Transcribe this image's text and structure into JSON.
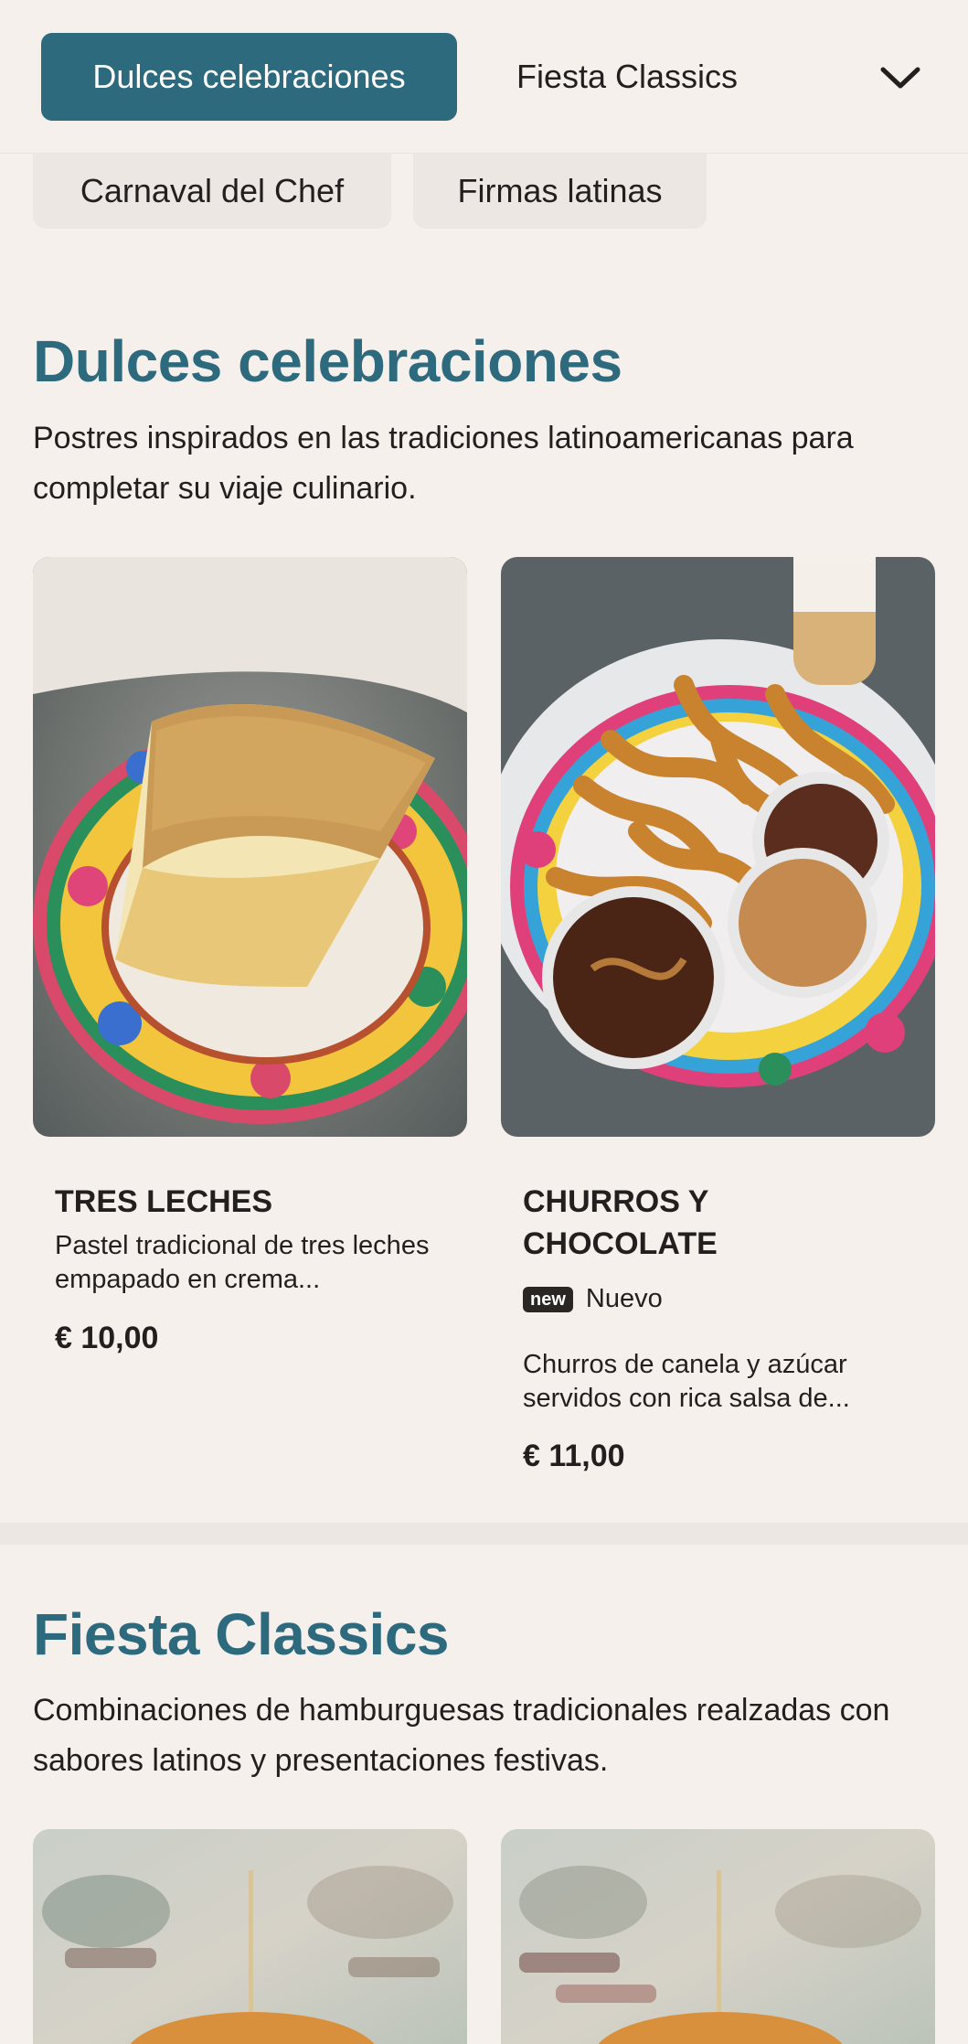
{
  "nav": {
    "active_category": "Dulces celebraciones",
    "second_category": "Fiesta Classics",
    "more_icon": "chevron-down-icon",
    "row2": [
      "Carnaval del Chef",
      "Firmas latinas"
    ]
  },
  "sections": [
    {
      "title": "Dulces celebraciones",
      "description": "Postres inspirados en las tradiciones latinoamericanas para completar su viaje culinario.",
      "items": [
        {
          "name": "TRES LECHES",
          "description": "Pastel tradicional de tres leches empapado en crema...",
          "price": "€ 10,00"
        },
        {
          "name": "CHURROS Y CHOCOLATE",
          "badge": "new",
          "badge_label": "Nuevo",
          "description": "Churros de canela y azúcar servidos con rica salsa de...",
          "price": "€ 11,00"
        }
      ]
    },
    {
      "title": "Fiesta Classics",
      "description": "Combinaciones de hamburguesas tradicionales realzadas con sabores latinos y presentaciones festivas."
    }
  ],
  "colors": {
    "accent": "#2d6a7d",
    "background": "#f5f0ec",
    "pill": "#ece7e2",
    "text": "#231f1e"
  }
}
